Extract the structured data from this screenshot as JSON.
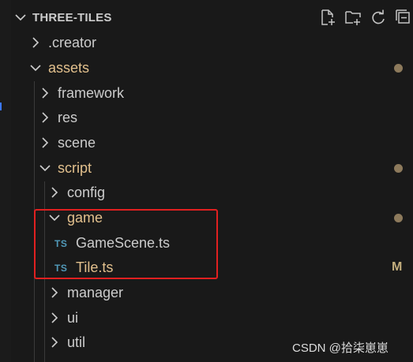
{
  "explorer": {
    "title": "THREE-TILES",
    "actions": [
      {
        "name": "new-file",
        "icon": "new-file-icon"
      },
      {
        "name": "new-folder",
        "icon": "new-folder-icon"
      },
      {
        "name": "refresh",
        "icon": "refresh-icon"
      },
      {
        "name": "collapse-all",
        "icon": "collapse-all-icon"
      }
    ]
  },
  "tree": {
    "creator": ".creator",
    "assets": "assets",
    "framework": "framework",
    "res": "res",
    "scene": "scene",
    "script": "script",
    "config": "config",
    "game": "game",
    "gamescene_badge": "TS",
    "gamescene": "GameScene.ts",
    "tile_badge": "TS",
    "tile": "Tile.ts",
    "tile_status": "M",
    "manager": "manager",
    "ui": "ui",
    "util": "util"
  },
  "colors": {
    "modified": "#e2c08d",
    "ts_badge": "#519aba",
    "highlight_box": "#e02020"
  },
  "watermark": "CSDN @拾柒崽崽"
}
